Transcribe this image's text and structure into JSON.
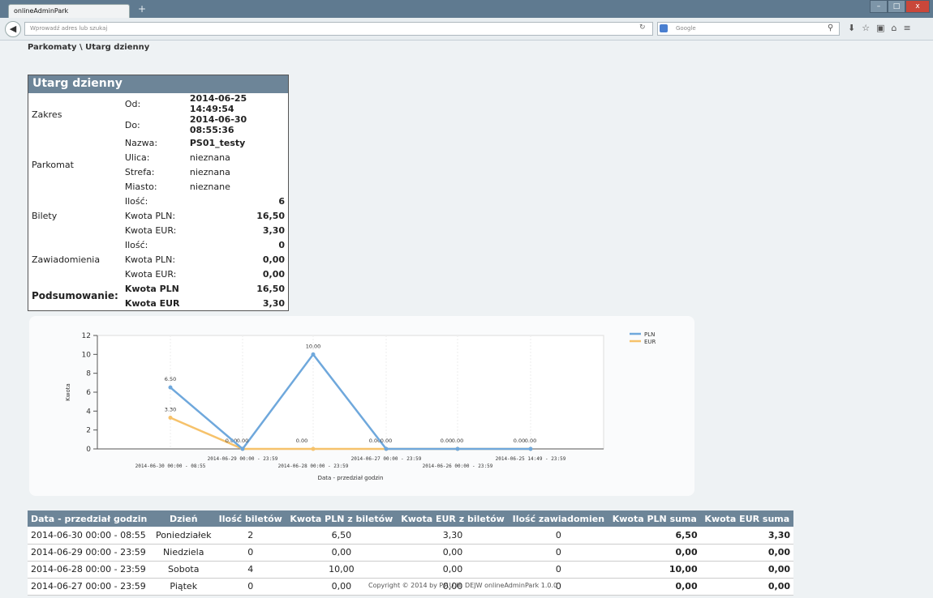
{
  "browser": {
    "tab_title": "onlineAdminPark",
    "new_tab": "+",
    "url_placeholder": "Wprowadź adres lub szukaj",
    "search_engine": "Google",
    "win_min": "–",
    "win_max": "□",
    "win_close": "x",
    "icons": [
      "search-icon",
      "download-icon",
      "star-icon",
      "bookmark-icon",
      "home-icon",
      "menu-icon"
    ]
  },
  "breadcrumb": "Parkomaty \\ Utarg dzienny",
  "summary": {
    "title": "Utarg dzienny",
    "rows": [
      {
        "group": "Zakres",
        "label": "Od:",
        "value": "2014-06-25 14:49:54",
        "kind": "val"
      },
      {
        "group": "",
        "label": "Do:",
        "value": "2014-06-30 08:55:36",
        "kind": "val"
      },
      {
        "group": "Parkomat",
        "label": "Nazwa:",
        "value": "PS01_testy",
        "kind": "val"
      },
      {
        "group": "",
        "label": "Ulica:",
        "value": "nieznana",
        "kind": "plain"
      },
      {
        "group": "",
        "label": "Strefa:",
        "value": "nieznana",
        "kind": "plain"
      },
      {
        "group": "",
        "label": "Miasto:",
        "value": "nieznane",
        "kind": "plain"
      },
      {
        "group": "Bilety",
        "label": "Ilość:",
        "value": "6",
        "kind": "num"
      },
      {
        "group": "",
        "label": "Kwota PLN:",
        "value": "16,50",
        "kind": "num"
      },
      {
        "group": "",
        "label": "Kwota EUR:",
        "value": "3,30",
        "kind": "num"
      },
      {
        "group": "Zawiadomienia",
        "label": "Ilość:",
        "value": "0",
        "kind": "num"
      },
      {
        "group": "",
        "label": "Kwota PLN:",
        "value": "0,00",
        "kind": "num"
      },
      {
        "group": "",
        "label": "Kwota EUR:",
        "value": "0,00",
        "kind": "num"
      },
      {
        "group": "Podsumowanie:",
        "label": "Kwota PLN",
        "value": "16,50",
        "kind": "sum"
      },
      {
        "group": "",
        "label": "Kwota EUR",
        "value": "3,30",
        "kind": "sum"
      }
    ]
  },
  "chart_data": {
    "type": "line",
    "xlabel": "Data - przedział godzin",
    "ylabel": "Kwota",
    "ylim": [
      0,
      12
    ],
    "yticks": [
      0,
      2,
      4,
      6,
      8,
      10,
      12
    ],
    "categories": [
      "2014-06-30 00:00 - 08:55",
      "2014-06-29 00:00 - 23:59",
      "2014-06-28 00:00 - 23:59",
      "2014-06-27 00:00 - 23:59",
      "2014-06-26 00:00 - 23:59",
      "2014-06-25 14:49 - 23:59"
    ],
    "series": [
      {
        "name": "PLN",
        "color": "#6fa8dc",
        "values": [
          6.5,
          0,
          10,
          0,
          0,
          0
        ],
        "labels": [
          "6.50",
          "0.00",
          "10.00",
          "0.00",
          "0.00",
          "0.00"
        ]
      },
      {
        "name": "EUR",
        "color": "#f6c26b",
        "values": [
          3.3,
          0,
          0,
          0,
          0,
          0
        ],
        "labels": [
          "3.30",
          "0.00",
          "0.00",
          "0.00",
          "0.00",
          "0.00"
        ]
      }
    ],
    "grid": true,
    "legend": "top-right"
  },
  "table": {
    "headers": [
      "Data - przedział godzin",
      "Dzień",
      "Ilość biletów",
      "Kwota PLN z biletów",
      "Kwota EUR z biletów",
      "Ilość zawiadomien",
      "Kwota PLN suma",
      "Kwota EUR suma"
    ],
    "rows": [
      [
        "2014-06-30 00:00 - 08:55",
        "Poniedziałek",
        "2",
        "6,50",
        "3,30",
        "0",
        "6,50",
        "3,30"
      ],
      [
        "2014-06-29 00:00 - 23:59",
        "Niedziela",
        "0",
        "0,00",
        "0,00",
        "0",
        "0,00",
        "0,00"
      ],
      [
        "2014-06-28 00:00 - 23:59",
        "Sobota",
        "4",
        "10,00",
        "0,00",
        "0",
        "10,00",
        "0,00"
      ],
      [
        "2014-06-27 00:00 - 23:59",
        "Piątek",
        "0",
        "0,00",
        "0,00",
        "0",
        "0,00",
        "0,00"
      ]
    ]
  },
  "footer": "Copyright © 2014 by P.P.U.H. DEJW onlineAdminPark 1.0.0"
}
